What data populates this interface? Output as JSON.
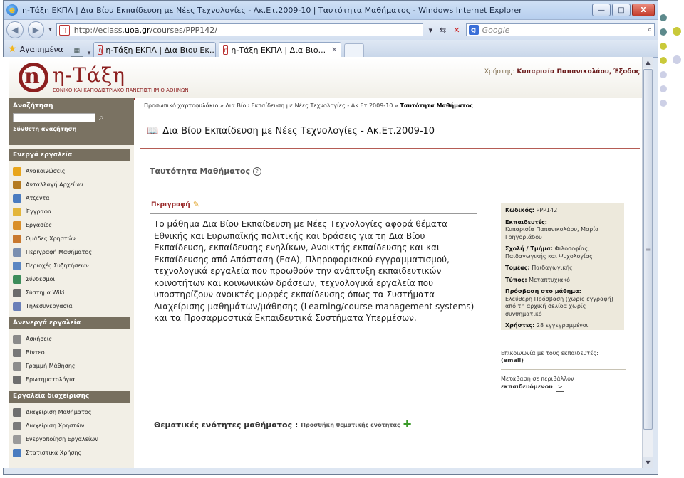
{
  "window": {
    "title": "η-Τάξη ΕΚΠΑ | Δια Βίου Εκπαίδευση με Νέες Τεχνολογίες - Ακ.Ετ.2009-10 | Ταυτότητα Μαθήματος - Windows Internet Explorer",
    "minimize": "—",
    "maximize": "□",
    "close": "X"
  },
  "address": {
    "url_prefix": "http://eclass.",
    "url_domain": "uoa.gr",
    "url_suffix": "/courses/PPP142/",
    "search_engine": "Google"
  },
  "favorites": {
    "label": "Αγαπημένα",
    "tabs": [
      {
        "label": "η-Τάξη ΕΚΠΑ | Δια Βιου Εκ..."
      },
      {
        "label": "η-Τάξη ΕΚΠΑ | Δια Βιο...",
        "close": "✕"
      }
    ]
  },
  "header": {
    "logo_text": "η-Τάξη",
    "logo_letter": "n",
    "logo_sub": "ΕΘΝΙΚΟ ΚΑΙ ΚΑΠΟΔΙΣΤΡΙΑΚΟ ΠΑΝΕΠΙΣΤΗΜΙΟ ΑΘΗΝΩΝ",
    "user_label": "Χρήστης:",
    "user_name": "Κυπαρισία Παπανικολάου,",
    "logout": "Έξοδος"
  },
  "sidebar": {
    "search_label": "Αναζήτηση",
    "advanced_search": "Σύνθετη αναζήτηση",
    "sections": [
      {
        "title": "Ενεργά εργαλεία",
        "items": [
          {
            "label": "Ανακοινώσεις",
            "icon": "megaphone-icon",
            "color": "#e8a51c"
          },
          {
            "label": "Ανταλλαγή Αρχείων",
            "icon": "box-icon",
            "color": "#b37a22"
          },
          {
            "label": "Ατζέντα",
            "icon": "calendar-icon",
            "color": "#4b7cc0"
          },
          {
            "label": "Έγγραφα",
            "icon": "folder-icon",
            "color": "#e3b53a"
          },
          {
            "label": "Εργασίες",
            "icon": "pencil-icon",
            "color": "#d98f2a"
          },
          {
            "label": "Ομάδες Χρηστών",
            "icon": "users-icon",
            "color": "#c8782e"
          },
          {
            "label": "Περιγραφή Μαθήματος",
            "icon": "document-icon",
            "color": "#7a8fb0"
          },
          {
            "label": "Περιοχές Συζητήσεων",
            "icon": "forum-icon",
            "color": "#5a86c2"
          },
          {
            "label": "Σύνδεσμοι",
            "icon": "globe-icon",
            "color": "#3c8c5a"
          },
          {
            "label": "Σύστημα Wiki",
            "icon": "wiki-icon",
            "color": "#6b6b6b"
          },
          {
            "label": "Τηλεσυνεργασία",
            "icon": "conference-icon",
            "color": "#6a7fb8"
          }
        ]
      },
      {
        "title": "Ανενεργά εργαλεία",
        "items": [
          {
            "label": "Ασκήσεις",
            "icon": "exercise-icon",
            "color": "#8a8a8a"
          },
          {
            "label": "Βίντεο",
            "icon": "video-icon",
            "color": "#777777"
          },
          {
            "label": "Γραμμή Μάθησης",
            "icon": "footprints-icon",
            "color": "#8c8c8c"
          },
          {
            "label": "Ερωτηματολόγια",
            "icon": "questionnaire-icon",
            "color": "#6e6e6e"
          }
        ]
      },
      {
        "title": "Εργαλεία διαχείρισης",
        "items": [
          {
            "label": "Διαχείριση Μαθήματος",
            "icon": "course-admin-icon",
            "color": "#6f6f6f"
          },
          {
            "label": "Διαχείριση Χρηστών",
            "icon": "users-admin-icon",
            "color": "#7a7a7a"
          },
          {
            "label": "Ενεργοποίηση Εργαλείων",
            "icon": "gear-icon",
            "color": "#9a9a9a"
          },
          {
            "label": "Στατιστικά Χρήσης",
            "icon": "stats-icon",
            "color": "#4a7cc0"
          }
        ]
      }
    ]
  },
  "main": {
    "breadcrumb": {
      "items": [
        "Προσωπικό χαρτοφυλάκιο",
        "Δια Βίου Εκπαίδευση με Νέες Τεχνολογίες - Ακ.Ετ.2009-10"
      ],
      "current": "Ταυτότητα Μαθήματος",
      "separator": "»"
    },
    "course_title": "Δια Βίου Εκπαίδευση με Νέες Τεχνολογίες - Ακ.Ετ.2009-10",
    "section_title": "Ταυτότητα Μαθήματος",
    "description_label": "Περιγραφή",
    "description": "Το μάθημα Δια Βίου Εκπαίδευση με Νέες Τεχνολογίες αφορά θέματα Εθνικής και Ευρωπαϊκής πολιτικής και δράσεις για τη Δια Βίου Εκπαίδευση, εκπαίδευσης ενηλίκων, Ανοικτής εκπαίδευσης και και Εκπαίδευσης από Απόσταση (ΕαΑ), Πληροφοριακού εγγραμματισμού, τεχνολογικά εργαλεία που προωθούν την ανάπτυξη εκπαιδευτικών κοινοτήτων και κοινωνικών δράσεων, τεχνολογικά εργαλεία που υποστηρίζουν ανοικτές μορφές εκπαίδευσης όπως τα Συστήματα Διαχείρισης μαθημάτων/μάθησης (Learning/course management systems) και τα Προσαρμοστικά Εκπαιδευτικά Συστήματα Υπερμέσων.",
    "info": {
      "code_label": "Κωδικός:",
      "code": "PPP142",
      "instructors_label": "Εκπαιδευτές:",
      "instructors": "Κυπαρισία Παπανικολάου, Μαρία Γρηγοριάδου",
      "school_label": "Σχολή / Τμήμα:",
      "school": "Φιλοσοφίας, Παιδαγωγικής και Ψυχολογίας",
      "sector_label": "Τομέας:",
      "sector": "Παιδαγωγικής",
      "type_label": "Τύπος:",
      "type": "Μεταπτυχιακό",
      "access_label": "Πρόσβαση στο μάθημα:",
      "access": "Ελεύθερη Πρόσβαση (χωρίς εγγραφή) από τη αρχική σελίδα χωρίς συνθηματικό",
      "users_label": "Χρήστες:",
      "users": "28 εγγεγραμμένοι"
    },
    "links": {
      "contact": "Επικοινωνία με τους εκπαιδευτές:",
      "contact_email": "(email)",
      "switch": "Μετάβαση σε περιβάλλον",
      "switch_bold": "εκπαιδευόμενου",
      "go": ">"
    },
    "topics_label": "Θεματικές ενότητες μαθήματος :",
    "add_topic": "Προσθήκη θεματικής ενότητας"
  }
}
